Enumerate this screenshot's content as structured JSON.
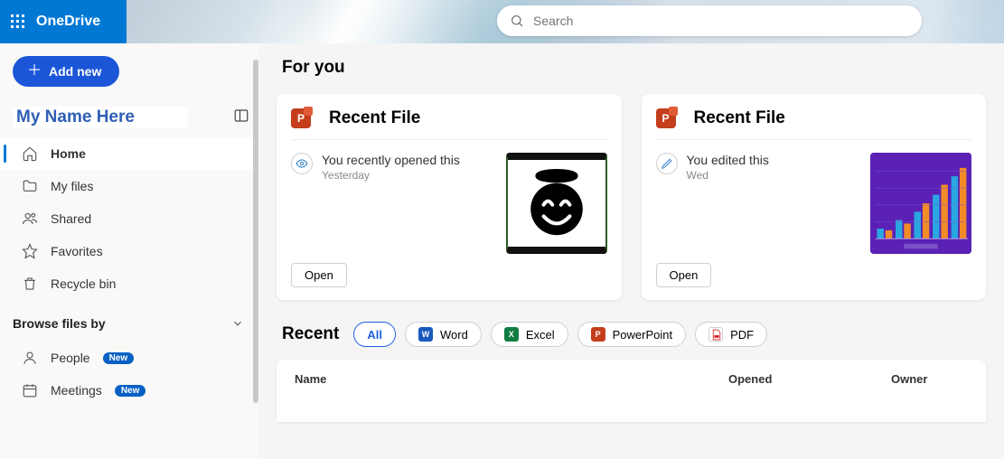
{
  "brand": {
    "name": "OneDrive"
  },
  "search": {
    "placeholder": "Search"
  },
  "sidebar": {
    "add_label": "Add new",
    "user_name": "My Name Here",
    "nav": {
      "home": "Home",
      "myfiles": "My files",
      "shared": "Shared",
      "favorites": "Favorites",
      "recycle": "Recycle bin"
    },
    "browse_header": "Browse files by",
    "browse": {
      "people": "People",
      "meetings": "Meetings",
      "badge": "New"
    }
  },
  "main": {
    "foryou": "For you",
    "cards": [
      {
        "app_letter": "P",
        "title": "Recent File",
        "activity": "You recently opened this",
        "when": "Yesterday",
        "open": "Open"
      },
      {
        "app_letter": "P",
        "title": "Recent File",
        "activity": "You edited this",
        "when": "Wed",
        "open": "Open"
      }
    ],
    "recent": {
      "title": "Recent",
      "chips": {
        "all": "All",
        "word": "Word",
        "excel": "Excel",
        "ppt": "PowerPoint",
        "pdf": "PDF"
      },
      "columns": {
        "name": "Name",
        "opened": "Opened",
        "owner": "Owner"
      }
    }
  }
}
